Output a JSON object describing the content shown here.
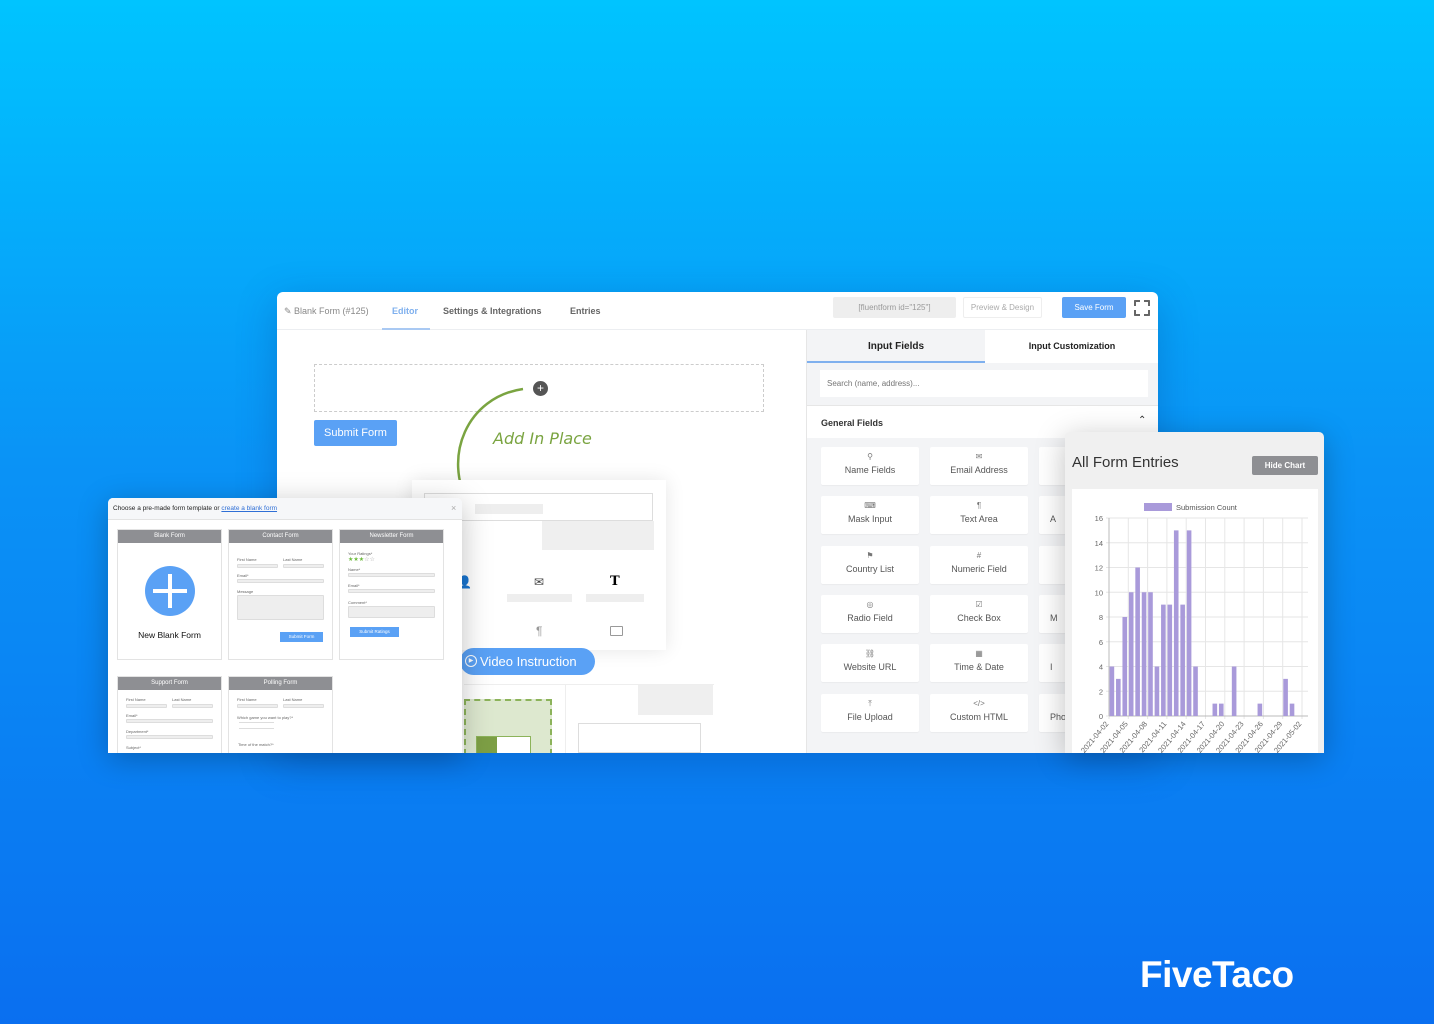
{
  "editor": {
    "form_title": "Blank Form (#125)",
    "tabs": [
      {
        "label": "Editor",
        "active": true
      },
      {
        "label": "Settings & Integrations"
      },
      {
        "label": "Entries"
      }
    ],
    "shortcode": "[fluentform id=\"125\"]",
    "preview_label": "Preview & Design",
    "save_label": "Save Form",
    "submit_label": "Submit Form",
    "add_in_place": "Add In Place",
    "video_instruction": "Video Instruction",
    "accent": "#4e9cf5",
    "annotation_color": "#7aa441"
  },
  "panel": {
    "tabs": [
      {
        "label": "Input Fields",
        "active": true
      },
      {
        "label": "Input Customization"
      }
    ],
    "search_placeholder": "Search (name, address)...",
    "section_title": "General Fields",
    "fields": [
      {
        "label": "Name Fields",
        "icon": "user-icon"
      },
      {
        "label": "Email Address",
        "icon": "envelope-icon"
      },
      {
        "label": "",
        "icon": ""
      },
      {
        "label": "Mask Input",
        "icon": "keyboard-icon"
      },
      {
        "label": "Text Area",
        "icon": "paragraph-icon"
      },
      {
        "label": "A",
        "icon": ""
      },
      {
        "label": "Country List",
        "icon": "flag-icon"
      },
      {
        "label": "Numeric Field",
        "icon": "hash-icon"
      },
      {
        "label": "",
        "icon": ""
      },
      {
        "label": "Radio Field",
        "icon": "radio-icon"
      },
      {
        "label": "Check Box",
        "icon": "checkbox-icon"
      },
      {
        "label": "M",
        "icon": ""
      },
      {
        "label": "Website URL",
        "icon": "link-icon"
      },
      {
        "label": "Time & Date",
        "icon": "calendar-icon"
      },
      {
        "label": "I",
        "icon": ""
      },
      {
        "label": "File Upload",
        "icon": "upload-icon"
      },
      {
        "label": "Custom HTML",
        "icon": "code-icon"
      },
      {
        "label": "Pho",
        "icon": ""
      }
    ]
  },
  "templates": {
    "prompt": "Choose a pre-made form template or ",
    "link": "create a blank form",
    "cards": {
      "blank": {
        "title": "Blank Form",
        "label": "New Blank Form"
      },
      "contact": {
        "title": "Contact Form",
        "first": "First Name",
        "last": "Last Name",
        "email": "Email*",
        "message": "Message",
        "button": "Submit Form"
      },
      "newsletter": {
        "title": "Newsletter Form",
        "ratings": "Your Ratings*",
        "name": "Name*",
        "email": "Email*",
        "comment": "Comment*",
        "button": "Submit Ratings",
        "stars": 3
      },
      "support": {
        "title": "Support Form",
        "first": "First Name",
        "last": "Last Name",
        "email": "Email*",
        "department": "Department*",
        "subject": "Subject*"
      },
      "polling": {
        "title": "Polling Form",
        "first": "First Name",
        "last": "Last Name",
        "question": "Which game you want to play?*",
        "time": "Time of the match?*"
      }
    }
  },
  "entries": {
    "title": "All Form Entries",
    "hide_label": "Hide Chart"
  },
  "chart_data": {
    "type": "bar",
    "legend": "Submission Count",
    "legend_position": "top",
    "bar_color": "#a99ada",
    "x_tick_labels": [
      "2021-04-02",
      "2021-04-05",
      "2021-04-08",
      "2021-04-11",
      "2021-04-14",
      "2021-04-17",
      "2021-04-20",
      "2021-04-23",
      "2021-04-26",
      "2021-04-29",
      "2021-05-02"
    ],
    "y_ticks": [
      0,
      2,
      4,
      6,
      8,
      10,
      12,
      14,
      16
    ],
    "ylim": [
      0,
      16
    ],
    "grid": true,
    "x": [
      "2021-04-03",
      "2021-04-04",
      "2021-04-05",
      "2021-04-06",
      "2021-04-07",
      "2021-04-08",
      "2021-04-09",
      "2021-04-10",
      "2021-04-11",
      "2021-04-12",
      "2021-04-13",
      "2021-04-14",
      "2021-04-15",
      "2021-04-16",
      "2021-04-19",
      "2021-04-20",
      "2021-04-22",
      "2021-04-26",
      "2021-04-30",
      "2021-05-01"
    ],
    "values": [
      4,
      3,
      8,
      10,
      12,
      10,
      10,
      4,
      9,
      9,
      15,
      9,
      15,
      4,
      1,
      1,
      4,
      1,
      3,
      1
    ]
  },
  "brand": "FiveTaco"
}
